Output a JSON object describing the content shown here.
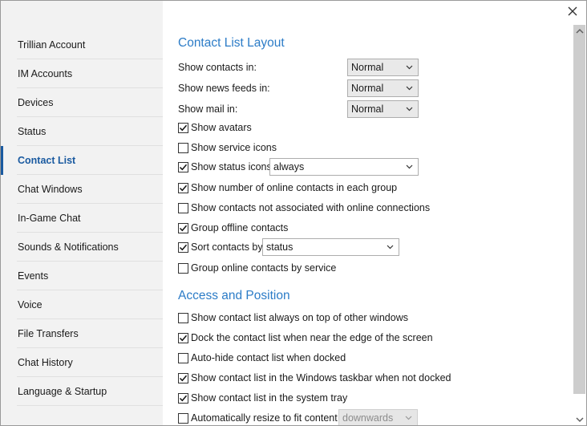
{
  "sidebar": {
    "items": [
      {
        "label": "Trillian Account",
        "active": false
      },
      {
        "label": "IM Accounts",
        "active": false
      },
      {
        "label": "Devices",
        "active": false
      },
      {
        "label": "Status",
        "active": false
      },
      {
        "label": "Contact List",
        "active": true
      },
      {
        "label": "Chat Windows",
        "active": false
      },
      {
        "label": "In-Game Chat",
        "active": false
      },
      {
        "label": "Sounds & Notifications",
        "active": false
      },
      {
        "label": "Events",
        "active": false
      },
      {
        "label": "Voice",
        "active": false
      },
      {
        "label": "File Transfers",
        "active": false
      },
      {
        "label": "Chat History",
        "active": false
      },
      {
        "label": "Language & Startup",
        "active": false
      }
    ]
  },
  "contact_list_layout": {
    "title": "Contact List Layout",
    "show_contacts_in": {
      "label": "Show contacts in:",
      "value": "Normal"
    },
    "show_news_feeds_in": {
      "label": "Show news feeds in:",
      "value": "Normal"
    },
    "show_mail_in": {
      "label": "Show mail in:",
      "value": "Normal"
    },
    "show_avatars": {
      "label": "Show avatars",
      "checked": true
    },
    "show_service_icons": {
      "label": "Show service icons",
      "checked": false
    },
    "show_status_icons": {
      "label": "Show status icons",
      "checked": true,
      "value": "always"
    },
    "show_online_count": {
      "label": "Show number of online contacts in each group",
      "checked": true
    },
    "show_unassociated": {
      "label": "Show contacts not associated with online connections",
      "checked": false
    },
    "group_offline": {
      "label": "Group offline contacts",
      "checked": true
    },
    "sort_contacts": {
      "label": "Sort contacts by",
      "checked": true,
      "value": "status"
    },
    "group_online_by_service": {
      "label": "Group online contacts by service",
      "checked": false
    }
  },
  "access_position": {
    "title": "Access and Position",
    "always_on_top": {
      "label": "Show contact list always on top of other windows",
      "checked": false
    },
    "dock_near_edge": {
      "label": "Dock the contact list when near the edge of the screen",
      "checked": true
    },
    "auto_hide": {
      "label": "Auto-hide contact list when docked",
      "checked": false
    },
    "show_in_taskbar": {
      "label": "Show contact list in the Windows taskbar when not docked",
      "checked": true
    },
    "show_in_tray": {
      "label": "Show contact list in the system tray",
      "checked": true
    },
    "auto_resize": {
      "label": "Automatically resize to fit content",
      "checked": false,
      "value": "downwards",
      "disabled": true
    }
  },
  "colors": {
    "accent": "#2c7cc7",
    "active_nav": "#1a5aa0",
    "sidebar_bg": "#f2f2f2"
  },
  "icons": {
    "close": "close-icon",
    "checkbox_check": "checkmark-icon",
    "dropdown": "chevron-down-icon"
  }
}
